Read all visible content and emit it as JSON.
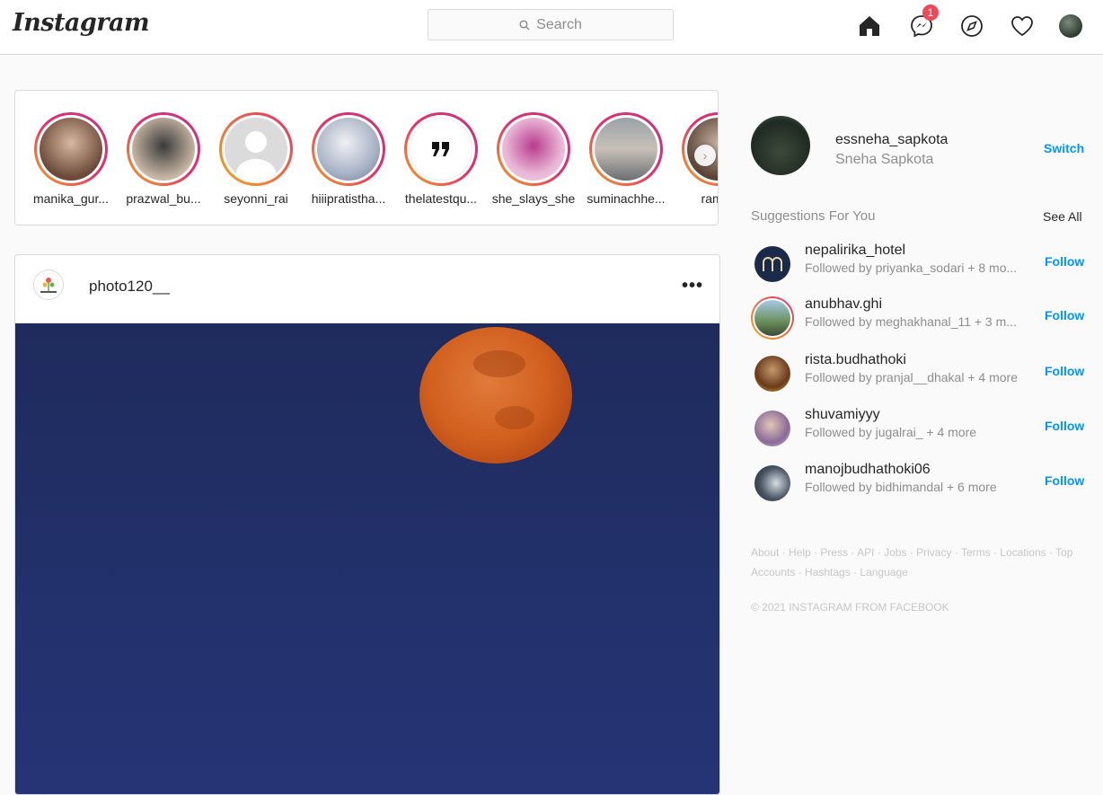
{
  "nav": {
    "logo": "Instagram",
    "search_placeholder": "Search",
    "messenger_badge": "1",
    "icons": [
      "home-icon",
      "messenger-icon",
      "explore-icon",
      "heart-icon",
      "avatar"
    ]
  },
  "stories": [
    {
      "name": "manika_gur..."
    },
    {
      "name": "prazwal_bu..."
    },
    {
      "name": "seyonni_rai"
    },
    {
      "name": "hiiipratistha..."
    },
    {
      "name": "thelatestqu..."
    },
    {
      "name": "she_slays_she"
    },
    {
      "name": "suminachhe..."
    },
    {
      "name": "ramita"
    }
  ],
  "post": {
    "username": "photo120__",
    "more": "•••"
  },
  "profile": {
    "username": "essneha_sapkota",
    "full_name": "Sneha Sapkota",
    "switch_label": "Switch"
  },
  "suggestions": {
    "title": "Suggestions For You",
    "see_all": "See All",
    "items": [
      {
        "username": "nepalirika_hotel",
        "sub": "Followed by priyanka_sodari + 8 mo...",
        "follow": "Follow"
      },
      {
        "username": "anubhav.ghi",
        "sub": "Followed by meghakhanal_11 + 3 m...",
        "follow": "Follow"
      },
      {
        "username": "rista.budhathoki",
        "sub": "Followed by pranjal__dhakal + 4 more",
        "follow": "Follow"
      },
      {
        "username": "shuvamiyyy",
        "sub": "Followed by jugalrai_ + 4 more",
        "follow": "Follow"
      },
      {
        "username": "manojbudhathoki06",
        "sub": "Followed by bidhimandal + 6 more",
        "follow": "Follow"
      }
    ]
  },
  "footer": {
    "links": [
      "About",
      "Help",
      "Press",
      "API",
      "Jobs",
      "Privacy",
      "Terms",
      "Locations",
      "Top Accounts",
      "Hashtags",
      "Language"
    ],
    "copyright": "© 2021 INSTAGRAM FROM FACEBOOK"
  },
  "colors": {
    "accent": "#0095f6",
    "badge": "#ed4956",
    "border": "#dbdbdb"
  }
}
